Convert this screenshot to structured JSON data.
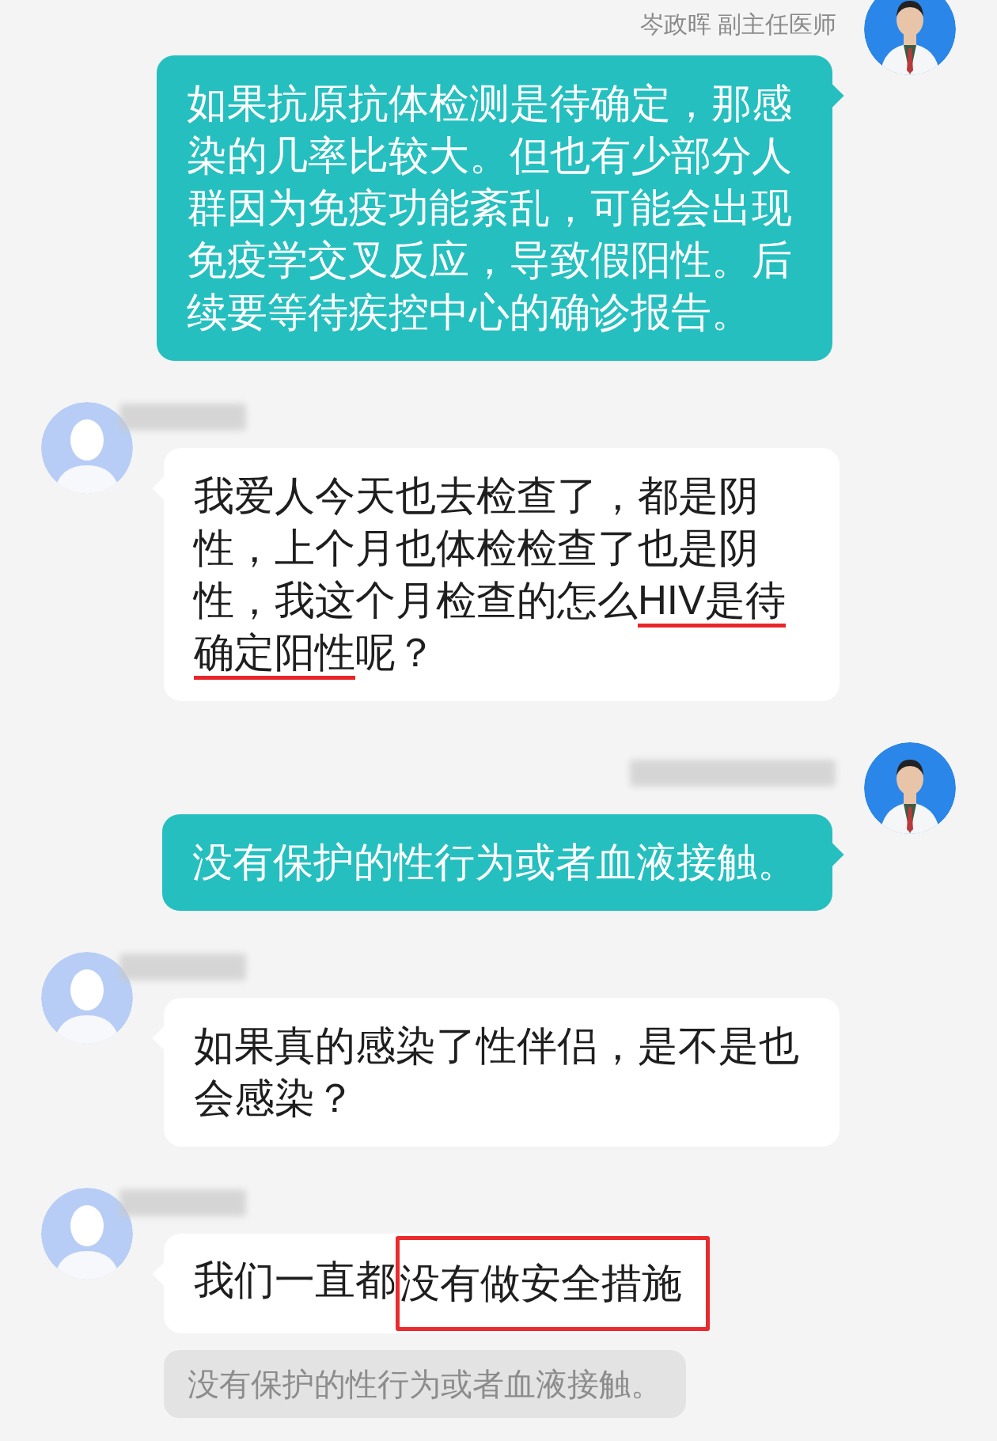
{
  "messages": [
    {
      "kind": "doctor",
      "sender": {
        "kind": "text",
        "text": "岑政晖 副主任医师"
      },
      "parts": [
        {
          "text": "如果抗原抗体检测是待确定，那感染的几率比较大。但也有少部分人群因为免疫功能紊乱，可能会出现免疫学交叉反应，导致假阳性。后续要等待疾控中心的确诊报告。",
          "kind": "plain"
        }
      ]
    },
    {
      "kind": "patient",
      "sender": {
        "kind": "blurred"
      },
      "parts": [
        {
          "text": "我爱人今天也去检查了，都是阴性，上个月也体检检查了也是阴性，我这个月检查的怎么",
          "kind": "plain"
        },
        {
          "text": "HIV是待",
          "kind": "underline"
        },
        {
          "text": "确定阳性",
          "kind": "underline"
        },
        {
          "text": "呢？",
          "kind": "plain"
        }
      ]
    },
    {
      "kind": "doctor",
      "sender": {
        "kind": "blurred"
      },
      "parts": [
        {
          "text": "没有保护的性行为或者血液接触。",
          "kind": "plain"
        }
      ]
    },
    {
      "kind": "patient",
      "sender": {
        "kind": "blurred"
      },
      "parts": [
        {
          "text": "如果真的感染了性伴侣，是不是也会感染？",
          "kind": "plain"
        }
      ]
    },
    {
      "kind": "patient",
      "sender": {
        "kind": "blurred"
      },
      "parts": [
        {
          "text": "我们一直都",
          "kind": "plain"
        },
        {
          "text": "没有做安全措施",
          "kind": "box"
        }
      ],
      "quote": "没有保护的性行为或者血液接触。"
    }
  ]
}
